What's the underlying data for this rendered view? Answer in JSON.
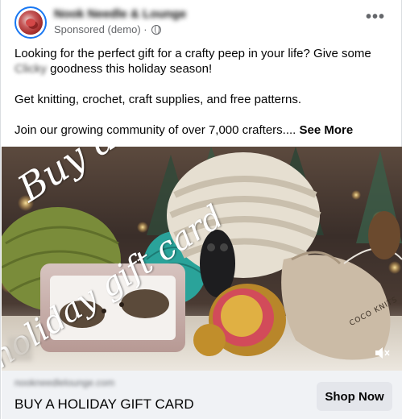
{
  "post": {
    "page_name": "Nook Needle & Lounge",
    "meta": "Sponsored (demo) ·",
    "more_icon": "more-dots-icon",
    "privacy_icon": "globe-icon"
  },
  "body": {
    "line1_prefix": "Looking for the perfect gift for a crafty peep in your life? Give some",
    "line1_blurred": "Clicky",
    "line1_suffix": " goodness this holiday season!",
    "line2": "Get knitting, crochet, craft supplies, and free patterns.",
    "line3": "Join our growing community of over 7,000 crafters.... ",
    "see_more": "See More"
  },
  "image": {
    "overlay_line1": "Buy a",
    "overlay_line2": "holiday gift card",
    "pouch_label": "COCO KNITS",
    "sound_icon": "speaker-muted-icon"
  },
  "cta": {
    "url": "nookneedlelounge.com",
    "title": "BUY A HOLIDAY GIFT CARD",
    "button": "Shop Now"
  }
}
